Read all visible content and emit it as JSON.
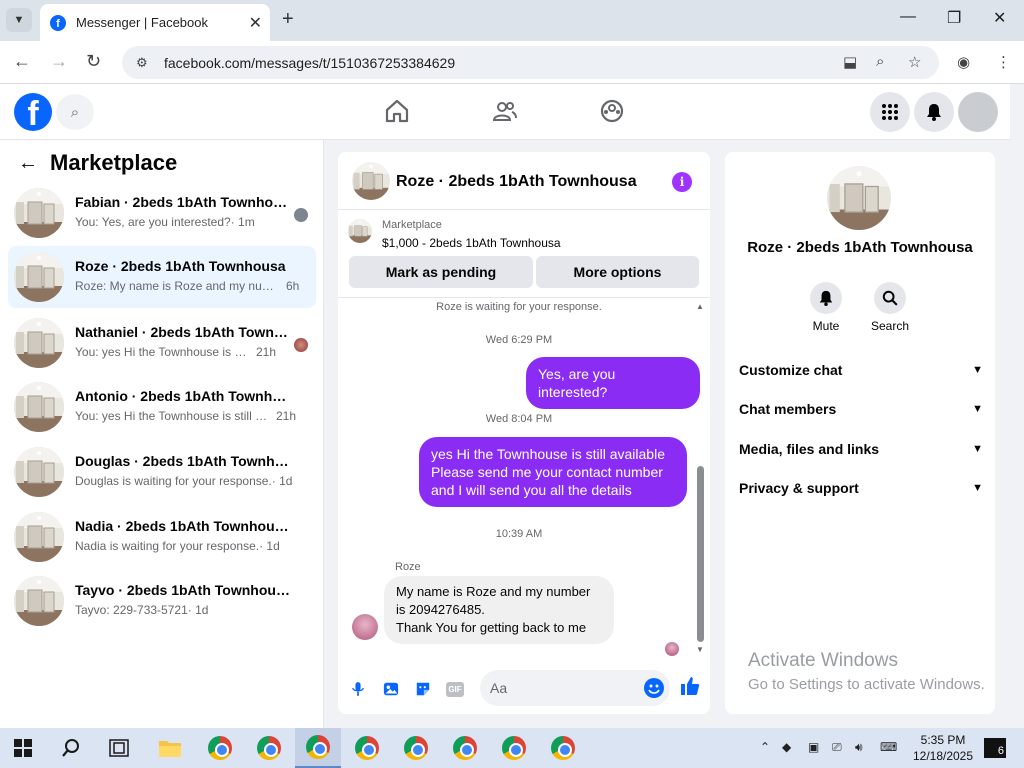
{
  "browser": {
    "tab_title": "Messenger | Facebook",
    "url": "facebook.com/messages/t/1510367253384629"
  },
  "fb": {
    "logo_letter": "f"
  },
  "left_panel": {
    "title": "Marketplace",
    "conversations": [
      {
        "name": "Fabian · 2beds 1bAth Townhousa",
        "preview": "You: Yes, are you interested?",
        "time": "· 1m",
        "active": false
      },
      {
        "name": "Roze · 2beds 1bAth Townhousa",
        "preview": "Roze: My name is Roze and my numb...",
        "time": "6h",
        "active": true
      },
      {
        "name": "Nathaniel · 2beds 1bAth Townho...",
        "preview": "You: yes Hi the Townhouse is still ...",
        "time": "21h",
        "active": false
      },
      {
        "name": "Antonio · 2beds 1bAth Townhousa",
        "preview": "You: yes Hi the Townhouse is still ava...",
        "time": "21h",
        "active": false
      },
      {
        "name": "Douglas · 2beds 1bAth Townhousa",
        "preview": "Douglas is waiting for your response.",
        "time": "· 1d",
        "active": false
      },
      {
        "name": "Nadia · 2beds 1bAth Townhousa",
        "preview": "Nadia is waiting for your response.",
        "time": "· 1d",
        "active": false
      },
      {
        "name": "Tayvo · 2beds 1bAth Townhousa",
        "preview": "Tayvo: 229-733-5721",
        "time": "· 1d",
        "active": false
      }
    ]
  },
  "chat": {
    "title": "Roze · 2beds 1bAth Townhousa",
    "listing_source": "Marketplace",
    "listing_price": "$1,000 - 2beds 1bAth Townhousa",
    "mark_pending": "Mark as pending",
    "more_options": "More options",
    "waiting_note": "Roze is waiting for your response.",
    "time1": "Wed 6:29 PM",
    "msg_out_1": "Yes, are you interested?",
    "time2": "Wed 8:04 PM",
    "msg_out_2_lines": [
      "yes Hi the Townhouse is still available",
      "Please send me your contact number",
      "and I will send you all the details"
    ],
    "time3": "10:39 AM",
    "sender_name": "Roze",
    "msg_in_lines": [
      "My name is Roze and my number",
      "is 2094276485.",
      "Thank You for getting back to me"
    ],
    "composer_placeholder": "Aa",
    "info_letter": "i",
    "gif_label": "GIF"
  },
  "right_panel": {
    "title": "Roze · 2beds 1bAth Townhousa",
    "mute_label": "Mute",
    "search_label": "Search",
    "sections": [
      "Customize chat",
      "Chat members",
      "Media, files and links",
      "Privacy & support"
    ]
  },
  "watermark": {
    "line1": "Activate Windows",
    "line2": "Go to Settings to activate Windows."
  },
  "taskbar": {
    "time": "5:35 PM",
    "date": "12/18/2025",
    "notifications": "6"
  },
  "colors": {
    "fb_blue": "#0866ff",
    "messenger_purple": "#8a2cf4",
    "active_row": "#ebf5ff"
  }
}
